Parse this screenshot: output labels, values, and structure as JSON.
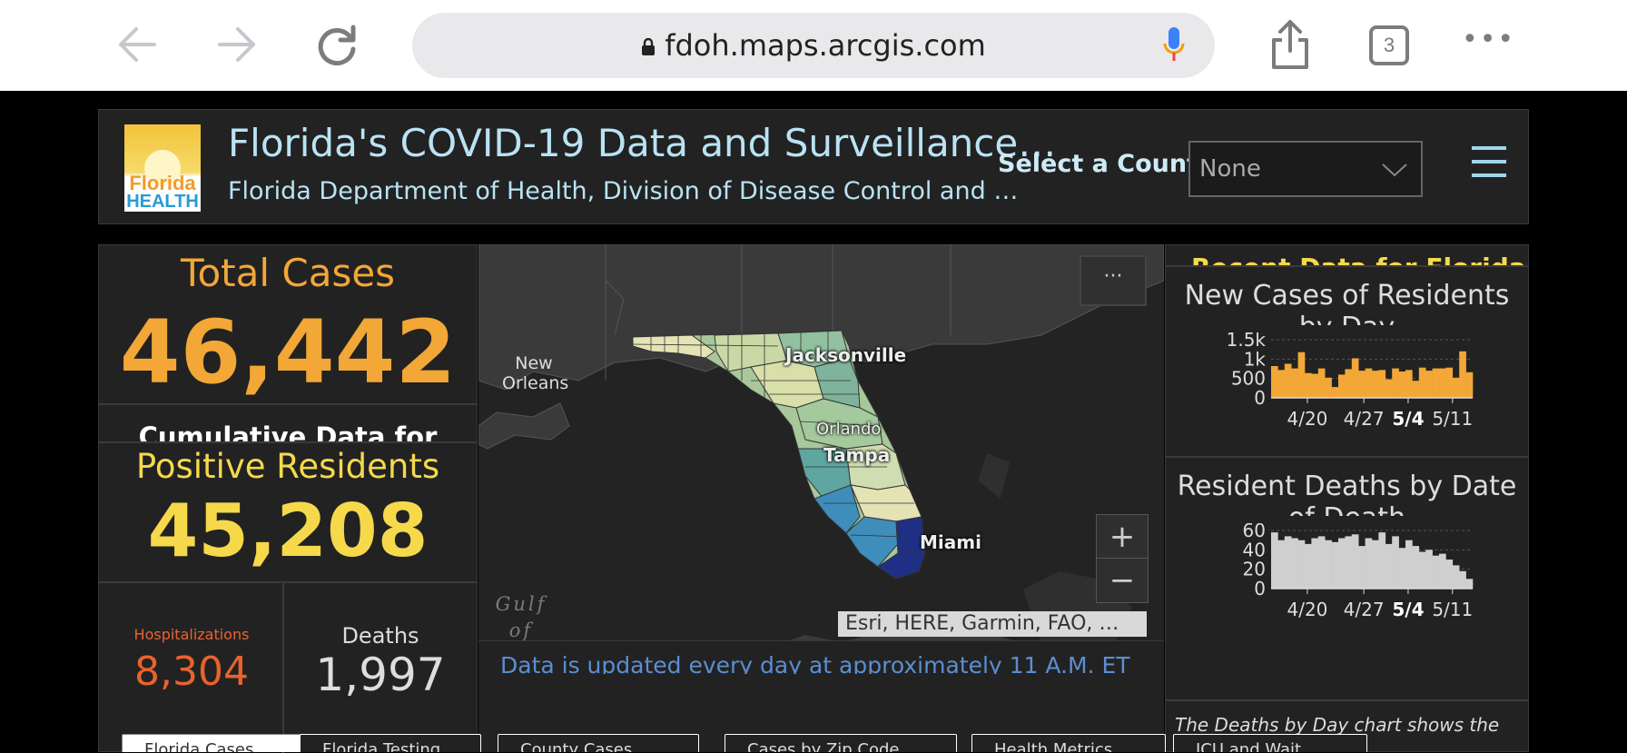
{
  "browser": {
    "url": "fdoh.maps.arcgis.com",
    "tab_count": "3",
    "more": "•••"
  },
  "header": {
    "logo_line1": "Florida",
    "logo_line2": "HEALTH",
    "title": "Florida's COVID-19 Data and Surveillance…",
    "subtitle": "Florida Department of Health, Division of Disease Control and …",
    "county_label": "Select a County",
    "county_value": "None"
  },
  "stats": {
    "total_cases_label": "Total Cases",
    "total_cases_value": "46,442",
    "cumulative_label": "Cumulative Data for",
    "positive_label": "Positive Residents",
    "positive_value": "45,208",
    "hospitalizations_label": "Hospitalizations",
    "hospitalizations_value": "8,304",
    "deaths_label": "Deaths",
    "deaths_value": "1,997"
  },
  "map": {
    "labels": {
      "new_orleans": "New\nOrleans",
      "jacksonville": "Jacksonville",
      "orlando": "Orlando",
      "tampa": "Tampa",
      "miami": "Miami",
      "gulf": "Gulf of Mexico"
    },
    "more_button": "···",
    "zoom_in": "+",
    "zoom_out": "−",
    "attribution": "Esri, HERE, Garmin, FAO, …",
    "footer_text": "Data is updated every day at approximately 11 A.M. ET"
  },
  "right_panel": {
    "partial_heading": "Recent Data for Florida",
    "note": "The Deaths by Day chart shows the"
  },
  "chart_data": [
    {
      "type": "bar",
      "title": "New Cases of Residents by Day",
      "yticks": [
        "1.5k",
        "1k",
        "500",
        "0"
      ],
      "xticks": [
        "4/20",
        "4/27",
        "5/4",
        "5/11"
      ],
      "ylim": [
        0,
        1500
      ],
      "values": [
        820,
        720,
        880,
        760,
        1180,
        640,
        620,
        760,
        520,
        280,
        600,
        740,
        1020,
        700,
        760,
        700,
        720,
        480,
        760,
        680,
        720,
        440,
        780,
        700,
        760,
        760,
        780,
        520,
        1200,
        660
      ],
      "color": "#f2a736"
    },
    {
      "type": "bar",
      "title": "Resident Deaths by Date of Death",
      "yticks": [
        "60",
        "40",
        "20",
        "0"
      ],
      "xticks": [
        "4/20",
        "4/27",
        "5/4",
        "5/11"
      ],
      "ylim": [
        0,
        60
      ],
      "values": [
        58,
        50,
        54,
        52,
        50,
        46,
        52,
        54,
        50,
        48,
        52,
        54,
        56,
        44,
        52,
        50,
        58,
        46,
        54,
        42,
        50,
        44,
        38,
        40,
        34,
        36,
        30,
        24,
        18,
        10
      ],
      "color": "#cfcfcf"
    }
  ],
  "tabs": [
    "Florida Cases",
    "Florida Testing",
    "County Cases",
    "Cases by Zip Code",
    "Health Metrics",
    "ICU and Wait"
  ]
}
